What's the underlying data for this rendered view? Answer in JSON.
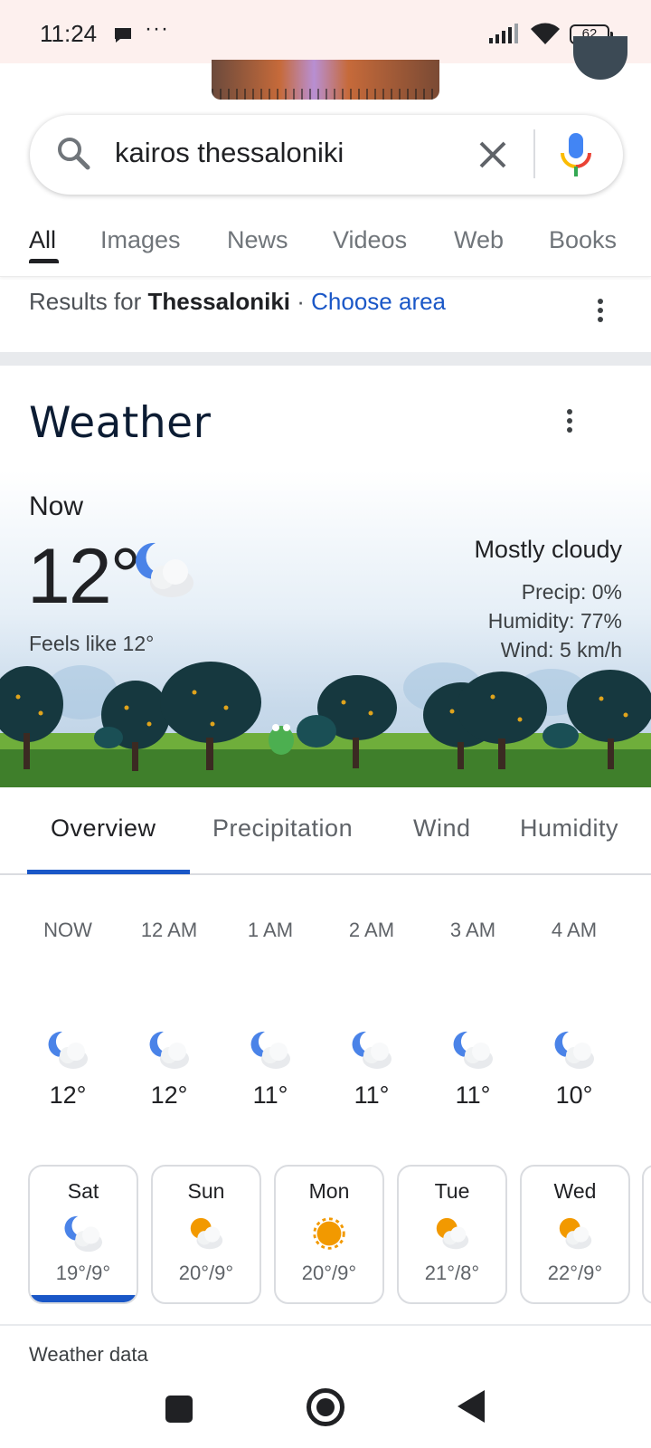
{
  "status_bar": {
    "time": "11:24",
    "more": "···",
    "battery": "62"
  },
  "search": {
    "query": "kairos thessaloniki"
  },
  "search_tabs": [
    "All",
    "Images",
    "News",
    "Videos",
    "Web",
    "Books"
  ],
  "location": {
    "prefix": "Results for",
    "place": "Thessaloniki",
    "separator": "·",
    "action": "Choose area"
  },
  "weather": {
    "title": "Weather",
    "now_label": "Now",
    "temperature": "12°",
    "feels_like": "Feels like 12°",
    "condition": "Mostly cloudy",
    "precip": "Precip: 0%",
    "humidity": "Humidity: 77%",
    "wind": "Wind: 5 km/h",
    "tabs": [
      "Overview",
      "Precipitation",
      "Wind",
      "Humidity"
    ],
    "hourly": [
      {
        "time": "NOW",
        "temp": "12°",
        "icon": "moon-cloud-icon"
      },
      {
        "time": "12 AM",
        "temp": "12°",
        "icon": "moon-cloud-icon"
      },
      {
        "time": "1 AM",
        "temp": "11°",
        "icon": "moon-cloud-icon"
      },
      {
        "time": "2 AM",
        "temp": "11°",
        "icon": "moon-cloud-icon"
      },
      {
        "time": "3 AM",
        "temp": "11°",
        "icon": "moon-cloud-icon"
      },
      {
        "time": "4 AM",
        "temp": "10°",
        "icon": "moon-cloud-icon"
      }
    ],
    "daily": [
      {
        "day": "Sat",
        "range": "19°/9°",
        "icon": "moon-cloud-icon",
        "selected": true
      },
      {
        "day": "Sun",
        "range": "20°/9°",
        "icon": "sun-cloud-icon"
      },
      {
        "day": "Mon",
        "range": "20°/9°",
        "icon": "sun-icon"
      },
      {
        "day": "Tue",
        "range": "21°/8°",
        "icon": "sun-cloud-icon"
      },
      {
        "day": "Wed",
        "range": "22°/9°",
        "icon": "sun-cloud-icon"
      }
    ],
    "footer": "Weather data"
  },
  "colors": {
    "accent": "#1a57c7",
    "sun": "#f29900",
    "moon": "#4a83e8"
  }
}
